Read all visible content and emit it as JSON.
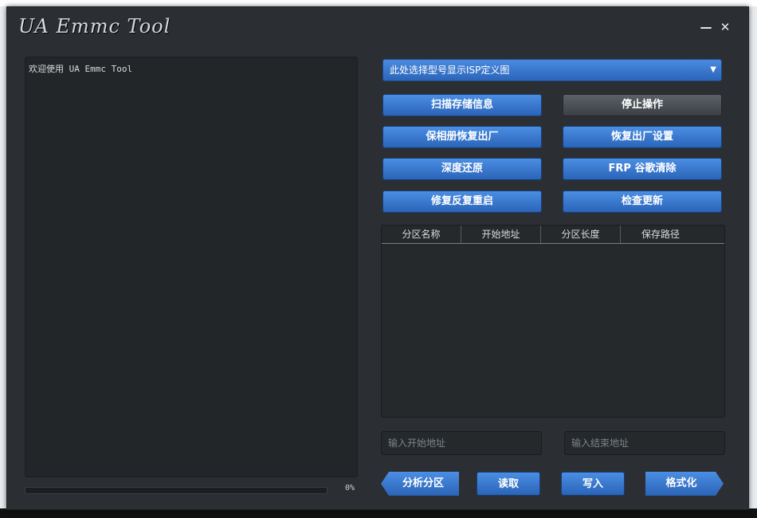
{
  "window": {
    "title": "UA Emmc Tool"
  },
  "log": {
    "text": "欢迎使用 UA Emmc Tool"
  },
  "progress": {
    "value": 0,
    "text": "0%"
  },
  "model_select": {
    "selected": "此处选择型号显示ISP定义图"
  },
  "buttons": {
    "scan": "扫描存储信息",
    "stop": "停止操作",
    "keep_photos_reset": "保相册恢复出厂",
    "factory_reset": "恢复出厂设置",
    "deep_restore": "深度还原",
    "frp_clear": "FRP 谷歌清除",
    "fix_reboot": "修复反复重启",
    "check_update": "检查更新",
    "analyze_partition": "分析分区",
    "read": "读取",
    "write": "写入",
    "format": "格式化"
  },
  "partition_table": {
    "columns": [
      "分区名称",
      "开始地址",
      "分区长度",
      "保存路径"
    ],
    "rows": []
  },
  "inputs": {
    "start_address_placeholder": "输入开始地址",
    "end_address_placeholder": "输入结束地址"
  }
}
